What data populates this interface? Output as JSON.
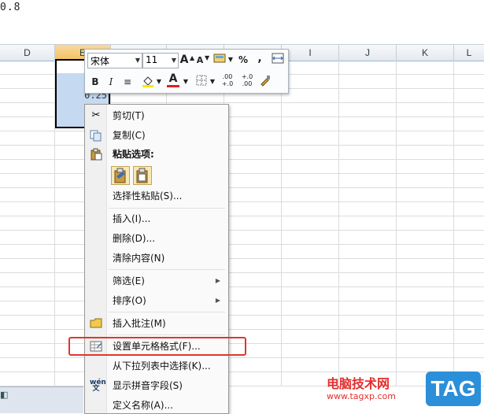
{
  "formula_bar": {
    "value": "0.8"
  },
  "columns": [
    {
      "label": "D"
    },
    {
      "label": "E"
    },
    {
      "label": "I"
    },
    {
      "label": "J"
    },
    {
      "label": "K"
    },
    {
      "label": "L"
    }
  ],
  "cell": {
    "value": "0.25"
  },
  "mini_toolbar": {
    "font_name": "宋体",
    "font_size": "11",
    "grow_font": "A",
    "shrink_font": "A",
    "percent": "%",
    "comma": ",",
    "bold": "B",
    "italic": "I",
    "font_color": "A",
    "decrease_decimal": "+.0 .00",
    "increase_decimal": ".00 +.0"
  },
  "context_menu": {
    "items": [
      {
        "label": "剪切(T)",
        "icon": "scissors-icon"
      },
      {
        "label": "复制(C)",
        "icon": "copy-icon"
      },
      {
        "label": "粘贴选项:",
        "icon": "paste-icon"
      },
      {
        "label": "选择性粘贴(S)...",
        "icon": ""
      },
      {
        "label": "插入(I)...",
        "icon": ""
      },
      {
        "label": "删除(D)...",
        "icon": ""
      },
      {
        "label": "清除内容(N)",
        "icon": ""
      },
      {
        "label": "筛选(E)",
        "icon": ""
      },
      {
        "label": "排序(O)",
        "icon": ""
      },
      {
        "label": "插入批注(M)",
        "icon": "comment-icon"
      },
      {
        "label": "设置单元格格式(F)...",
        "icon": "format-cells-icon"
      },
      {
        "label": "从下拉列表中选择(K)...",
        "icon": ""
      },
      {
        "label": "显示拼音字段(S)",
        "icon": "phonetic-icon"
      },
      {
        "label": "定义名称(A)...",
        "icon": ""
      }
    ],
    "phonetic_icon_text": "wén"
  },
  "watermark": {
    "cn_text": "电脑技术网",
    "url": "www.tagxp.com",
    "logo": "TAG"
  },
  "colors": {
    "highlight": "#e0362b",
    "selection": "#c5d9f1",
    "header_selected": "#f1c15f"
  }
}
